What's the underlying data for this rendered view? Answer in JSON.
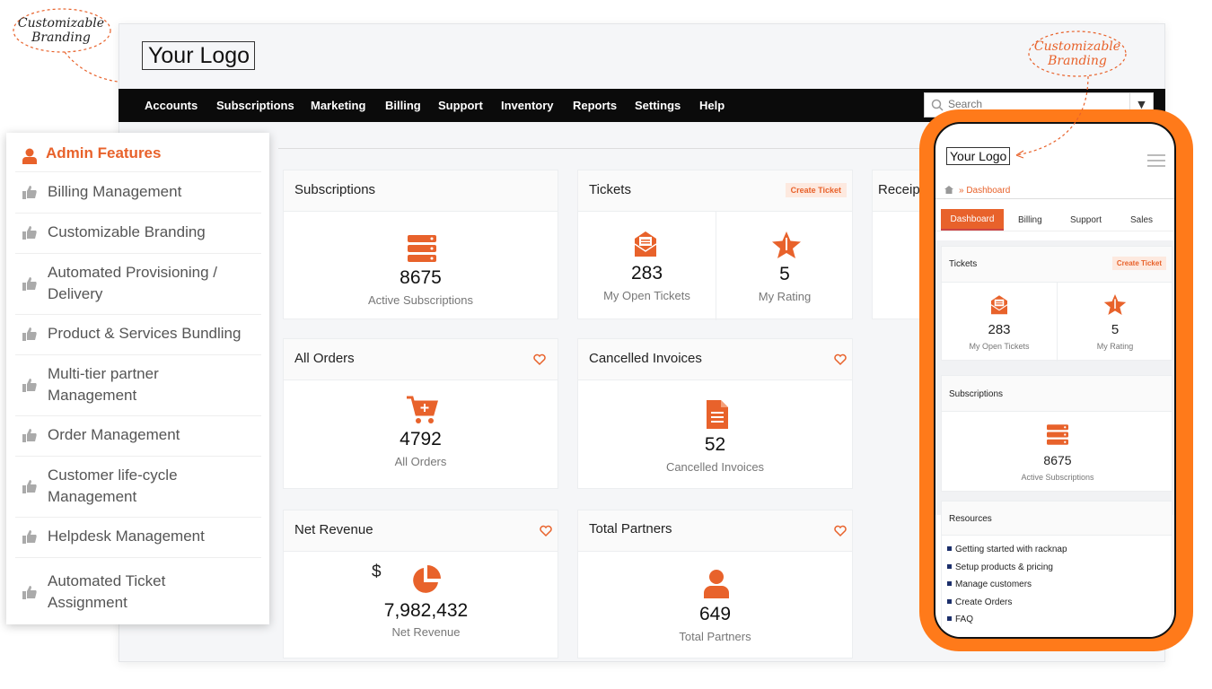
{
  "annotations": {
    "top_left": "Customizable Branding",
    "phone": "Customizable Branding"
  },
  "header": {
    "logo_text": "Your Logo"
  },
  "nav": {
    "items": [
      "Accounts",
      "Subscriptions",
      "Marketing",
      "Billing",
      "Support",
      "Inventory",
      "Reports",
      "Settings",
      "Help"
    ]
  },
  "search": {
    "placeholder": "Search"
  },
  "cards": {
    "subscriptions": {
      "title": "Subscriptions",
      "value": "8675",
      "label": "Active Subscriptions"
    },
    "tickets": {
      "title": "Tickets",
      "button": "Create Ticket",
      "open_value": "283",
      "open_label": "My Open Tickets",
      "rating_value": "5",
      "rating_label": "My Rating"
    },
    "receipts": {
      "title": "Receip"
    },
    "all_orders": {
      "title": "All Orders",
      "value": "4792",
      "label": "All Orders"
    },
    "cancelled_invoices": {
      "title": "Cancelled Invoices",
      "value": "52",
      "label": "Cancelled Invoices"
    },
    "net_revenue": {
      "title": "Net Revenue",
      "currency": "$",
      "value": "7,982,432",
      "label": "Net Revenue"
    },
    "total_partners": {
      "title": "Total Partners",
      "value": "649",
      "label": "Total Partners"
    }
  },
  "sidebar": {
    "title": "Admin Features",
    "items": [
      "Billing Management",
      "Customizable Branding",
      "Automated Provisioning / Delivery",
      "Product & Services Bundling",
      "Multi-tier partner Management",
      "Order Management",
      "Customer life-cycle Management",
      "Helpdesk Management",
      "Automated Ticket Assignment"
    ]
  },
  "phone": {
    "logo_text": "Your Logo",
    "breadcrumb": "» Dashboard",
    "tabs": [
      "Dashboard",
      "Billing",
      "Support",
      "Sales"
    ],
    "tickets": {
      "title": "Tickets",
      "button": "Create Ticket",
      "open_value": "283",
      "open_label": "My Open Tickets",
      "rating_value": "5",
      "rating_label": "My Rating"
    },
    "subscriptions": {
      "title": "Subscriptions",
      "value": "8675",
      "label": "Active Subscriptions"
    },
    "resources": {
      "title": "Resources",
      "links": [
        "Getting started with racknap",
        "Setup products & pricing",
        "Manage customers",
        "Create Orders",
        "FAQ"
      ]
    }
  },
  "colors": {
    "accent": "#e8622b",
    "phone_frame": "#ff7a1a",
    "nav_bg": "#0b0b0b"
  }
}
